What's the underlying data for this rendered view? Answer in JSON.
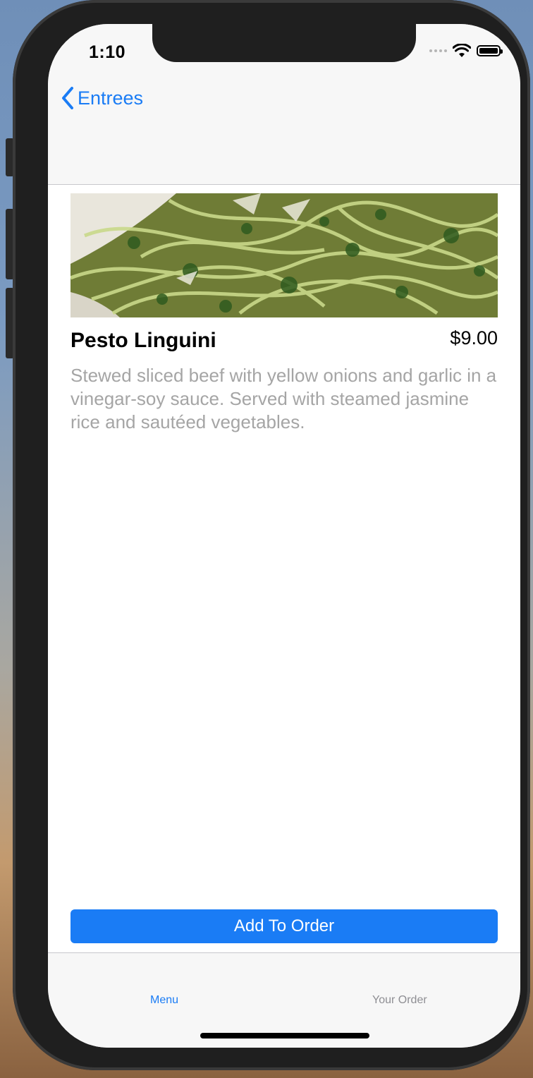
{
  "status_bar": {
    "time": "1:10"
  },
  "nav": {
    "back_label": "Entrees"
  },
  "item": {
    "name": "Pesto Linguini",
    "price": "$9.00",
    "description": "Stewed sliced beef with yellow onions and garlic in a vinegar-soy sauce. Served with steamed jasmine rice and sautéed vegetables.",
    "image_icon": "pasta-photo"
  },
  "actions": {
    "add_to_order_label": "Add To Order"
  },
  "tabs": [
    {
      "label": "Menu",
      "selected": true
    },
    {
      "label": "Your Order",
      "selected": false
    }
  ],
  "colors": {
    "accent": "#1a7cf5",
    "description_text": "#a5a5a5",
    "nav_background": "#f7f7f7"
  }
}
